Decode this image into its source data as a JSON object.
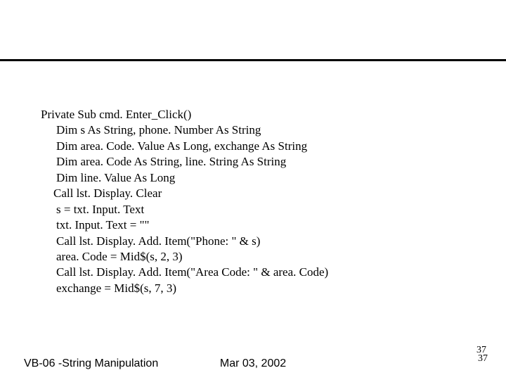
{
  "code": {
    "line1": "Private Sub cmd. Enter_Click()",
    "line2": "Dim s As String, phone. Number As String",
    "line3": "Dim area. Code. Value As Long, exchange As String",
    "line4": "Dim area. Code As String, line. String As String",
    "line5": "Dim line. Value As Long",
    "line6": "Call lst. Display. Clear",
    "line7": "s = txt. Input. Text",
    "line8": "txt. Input. Text = \"\"",
    "line9": "Call lst. Display. Add. Item(\"Phone: \" & s)",
    "line10": "area. Code = Mid$(s, 2, 3)",
    "line11": "Call lst. Display. Add. Item(\"Area Code: \" & area. Code)",
    "line12": "exchange = Mid$(s, 7, 3)"
  },
  "footer": {
    "left": "VB-06 -String Manipulation",
    "center": "Mar 03, 2002",
    "page_main": "37",
    "page_sub": "37"
  }
}
